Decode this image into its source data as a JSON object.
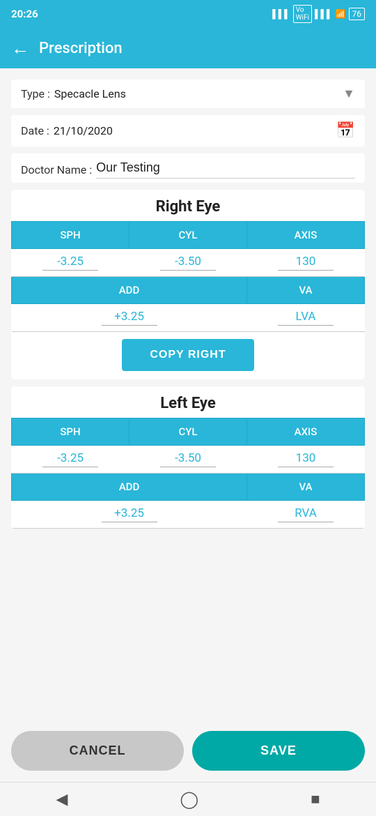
{
  "statusBar": {
    "time": "20:26",
    "battery": "76"
  },
  "navBar": {
    "title": "Prescription",
    "backArrow": "←"
  },
  "form": {
    "typeLabel": "Type :",
    "typeValue": "Specacle Lens",
    "dateLabel": "Date :",
    "dateValue": "21/10/2020",
    "doctorLabel": "Doctor Name :",
    "doctorValue": "Our Testing"
  },
  "rightEye": {
    "title": "Right Eye",
    "headers": [
      "SPH",
      "CYL",
      "AXIS"
    ],
    "values": [
      "-3.25",
      "-3.50",
      "130"
    ],
    "addVaHeaders": [
      "ADD",
      "VA"
    ],
    "addVaValues": [
      "+3.25",
      "LVA"
    ],
    "copyButton": "COPY RIGHT"
  },
  "leftEye": {
    "title": "Left Eye",
    "headers": [
      "SPH",
      "CYL",
      "AXIS"
    ],
    "values": [
      "-3.25",
      "-3.50",
      "130"
    ],
    "addVaHeaders": [
      "ADD",
      "VA"
    ],
    "addVaValues": [
      "+3.25",
      "RVA"
    ]
  },
  "buttons": {
    "cancel": "CANCEL",
    "save": "SAVE"
  }
}
